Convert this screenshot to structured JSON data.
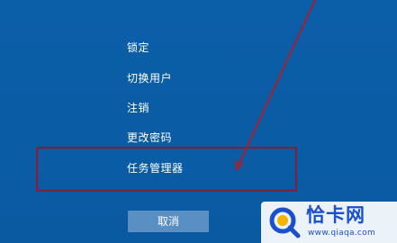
{
  "security_options": {
    "items": [
      {
        "label": "锁定"
      },
      {
        "label": "切换用户"
      },
      {
        "label": "注销"
      },
      {
        "label": "更改密码"
      },
      {
        "label": "任务管理器"
      }
    ],
    "cancel_label": "取消"
  },
  "watermark": {
    "title": "恰卡网",
    "url": "www.qiaqa.com"
  },
  "colors": {
    "background": "#0a5da6",
    "cancel_button": "#5a8fc4",
    "highlight_box": "#7a2340",
    "annotation_arrow": "#8a2a45",
    "watermark_text": "#1a4fd0"
  },
  "icons": {
    "annotation": "arrow-icon",
    "watermark_logo": "magnifier-logo"
  }
}
